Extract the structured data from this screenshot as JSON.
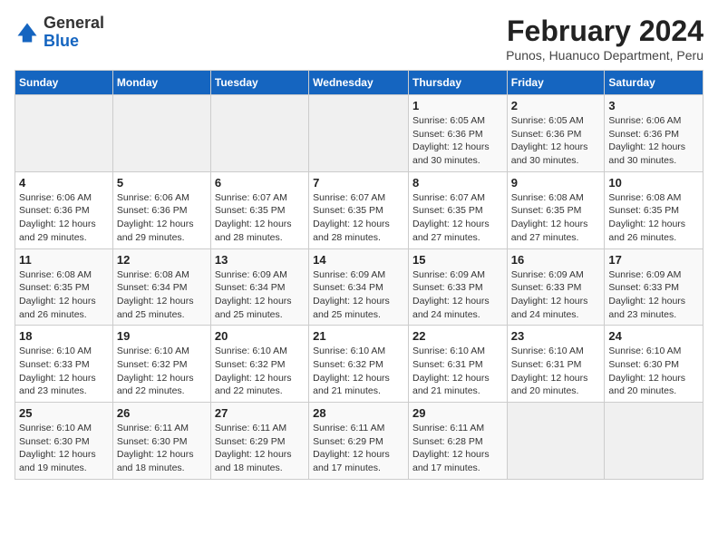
{
  "header": {
    "logo": {
      "general": "General",
      "blue": "Blue"
    },
    "title": "February 2024",
    "location": "Punos, Huanuco Department, Peru"
  },
  "days_of_week": [
    "Sunday",
    "Monday",
    "Tuesday",
    "Wednesday",
    "Thursday",
    "Friday",
    "Saturday"
  ],
  "weeks": [
    [
      {
        "day": "",
        "info": ""
      },
      {
        "day": "",
        "info": ""
      },
      {
        "day": "",
        "info": ""
      },
      {
        "day": "",
        "info": ""
      },
      {
        "day": "1",
        "info": "Sunrise: 6:05 AM\nSunset: 6:36 PM\nDaylight: 12 hours and 30 minutes."
      },
      {
        "day": "2",
        "info": "Sunrise: 6:05 AM\nSunset: 6:36 PM\nDaylight: 12 hours and 30 minutes."
      },
      {
        "day": "3",
        "info": "Sunrise: 6:06 AM\nSunset: 6:36 PM\nDaylight: 12 hours and 30 minutes."
      }
    ],
    [
      {
        "day": "4",
        "info": "Sunrise: 6:06 AM\nSunset: 6:36 PM\nDaylight: 12 hours and 29 minutes."
      },
      {
        "day": "5",
        "info": "Sunrise: 6:06 AM\nSunset: 6:36 PM\nDaylight: 12 hours and 29 minutes."
      },
      {
        "day": "6",
        "info": "Sunrise: 6:07 AM\nSunset: 6:35 PM\nDaylight: 12 hours and 28 minutes."
      },
      {
        "day": "7",
        "info": "Sunrise: 6:07 AM\nSunset: 6:35 PM\nDaylight: 12 hours and 28 minutes."
      },
      {
        "day": "8",
        "info": "Sunrise: 6:07 AM\nSunset: 6:35 PM\nDaylight: 12 hours and 27 minutes."
      },
      {
        "day": "9",
        "info": "Sunrise: 6:08 AM\nSunset: 6:35 PM\nDaylight: 12 hours and 27 minutes."
      },
      {
        "day": "10",
        "info": "Sunrise: 6:08 AM\nSunset: 6:35 PM\nDaylight: 12 hours and 26 minutes."
      }
    ],
    [
      {
        "day": "11",
        "info": "Sunrise: 6:08 AM\nSunset: 6:35 PM\nDaylight: 12 hours and 26 minutes."
      },
      {
        "day": "12",
        "info": "Sunrise: 6:08 AM\nSunset: 6:34 PM\nDaylight: 12 hours and 25 minutes."
      },
      {
        "day": "13",
        "info": "Sunrise: 6:09 AM\nSunset: 6:34 PM\nDaylight: 12 hours and 25 minutes."
      },
      {
        "day": "14",
        "info": "Sunrise: 6:09 AM\nSunset: 6:34 PM\nDaylight: 12 hours and 25 minutes."
      },
      {
        "day": "15",
        "info": "Sunrise: 6:09 AM\nSunset: 6:33 PM\nDaylight: 12 hours and 24 minutes."
      },
      {
        "day": "16",
        "info": "Sunrise: 6:09 AM\nSunset: 6:33 PM\nDaylight: 12 hours and 24 minutes."
      },
      {
        "day": "17",
        "info": "Sunrise: 6:09 AM\nSunset: 6:33 PM\nDaylight: 12 hours and 23 minutes."
      }
    ],
    [
      {
        "day": "18",
        "info": "Sunrise: 6:10 AM\nSunset: 6:33 PM\nDaylight: 12 hours and 23 minutes."
      },
      {
        "day": "19",
        "info": "Sunrise: 6:10 AM\nSunset: 6:32 PM\nDaylight: 12 hours and 22 minutes."
      },
      {
        "day": "20",
        "info": "Sunrise: 6:10 AM\nSunset: 6:32 PM\nDaylight: 12 hours and 22 minutes."
      },
      {
        "day": "21",
        "info": "Sunrise: 6:10 AM\nSunset: 6:32 PM\nDaylight: 12 hours and 21 minutes."
      },
      {
        "day": "22",
        "info": "Sunrise: 6:10 AM\nSunset: 6:31 PM\nDaylight: 12 hours and 21 minutes."
      },
      {
        "day": "23",
        "info": "Sunrise: 6:10 AM\nSunset: 6:31 PM\nDaylight: 12 hours and 20 minutes."
      },
      {
        "day": "24",
        "info": "Sunrise: 6:10 AM\nSunset: 6:30 PM\nDaylight: 12 hours and 20 minutes."
      }
    ],
    [
      {
        "day": "25",
        "info": "Sunrise: 6:10 AM\nSunset: 6:30 PM\nDaylight: 12 hours and 19 minutes."
      },
      {
        "day": "26",
        "info": "Sunrise: 6:11 AM\nSunset: 6:30 PM\nDaylight: 12 hours and 18 minutes."
      },
      {
        "day": "27",
        "info": "Sunrise: 6:11 AM\nSunset: 6:29 PM\nDaylight: 12 hours and 18 minutes."
      },
      {
        "day": "28",
        "info": "Sunrise: 6:11 AM\nSunset: 6:29 PM\nDaylight: 12 hours and 17 minutes."
      },
      {
        "day": "29",
        "info": "Sunrise: 6:11 AM\nSunset: 6:28 PM\nDaylight: 12 hours and 17 minutes."
      },
      {
        "day": "",
        "info": ""
      },
      {
        "day": "",
        "info": ""
      }
    ]
  ]
}
